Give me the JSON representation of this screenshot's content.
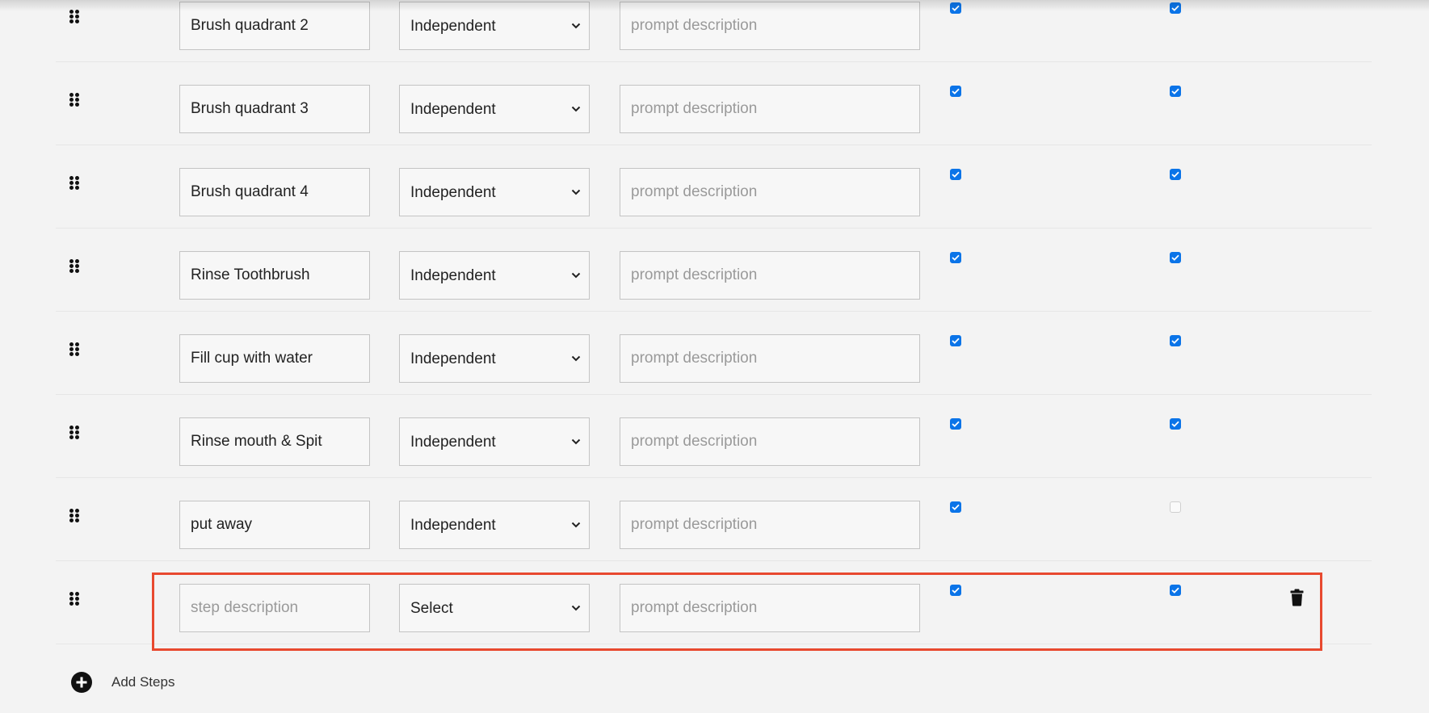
{
  "colors": {
    "background": "#f3f3f3",
    "checkbox_checked": "#0b74e8",
    "highlight_border": "#e8492f"
  },
  "steps": [
    {
      "step_value": "Brush quadrant 2",
      "step_placeholder": "step description",
      "level": "Independent",
      "prompt_value": "",
      "prompt_placeholder": "prompt description",
      "check_1": true,
      "check_2": true,
      "deletable": false
    },
    {
      "step_value": "Brush quadrant 3",
      "step_placeholder": "step description",
      "level": "Independent",
      "prompt_value": "",
      "prompt_placeholder": "prompt description",
      "check_1": true,
      "check_2": true,
      "deletable": false
    },
    {
      "step_value": "Brush quadrant 4",
      "step_placeholder": "step description",
      "level": "Independent",
      "prompt_value": "",
      "prompt_placeholder": "prompt description",
      "check_1": true,
      "check_2": true,
      "deletable": false
    },
    {
      "step_value": "Rinse Toothbrush",
      "step_placeholder": "step description",
      "level": "Independent",
      "prompt_value": "",
      "prompt_placeholder": "prompt description",
      "check_1": true,
      "check_2": true,
      "deletable": false
    },
    {
      "step_value": "Fill cup with water",
      "step_placeholder": "step description",
      "level": "Independent",
      "prompt_value": "",
      "prompt_placeholder": "prompt description",
      "check_1": true,
      "check_2": true,
      "deletable": false
    },
    {
      "step_value": "Rinse mouth & Spit",
      "step_placeholder": "step description",
      "level": "Independent",
      "prompt_value": "",
      "prompt_placeholder": "prompt description",
      "check_1": true,
      "check_2": true,
      "deletable": false
    },
    {
      "step_value": "put away",
      "step_placeholder": "step description",
      "level": "Independent",
      "prompt_value": "",
      "prompt_placeholder": "prompt description",
      "check_1": true,
      "check_2": false,
      "deletable": false
    },
    {
      "step_value": "",
      "step_placeholder": "step description",
      "level": "Select",
      "prompt_value": "",
      "prompt_placeholder": "prompt description",
      "check_1": true,
      "check_2": true,
      "deletable": true,
      "highlighted": true
    }
  ],
  "icons": {
    "drag": "drag-handle-icon",
    "delete": "trash-icon",
    "add": "plus-circle-icon"
  },
  "add_steps_label": "Add Steps"
}
